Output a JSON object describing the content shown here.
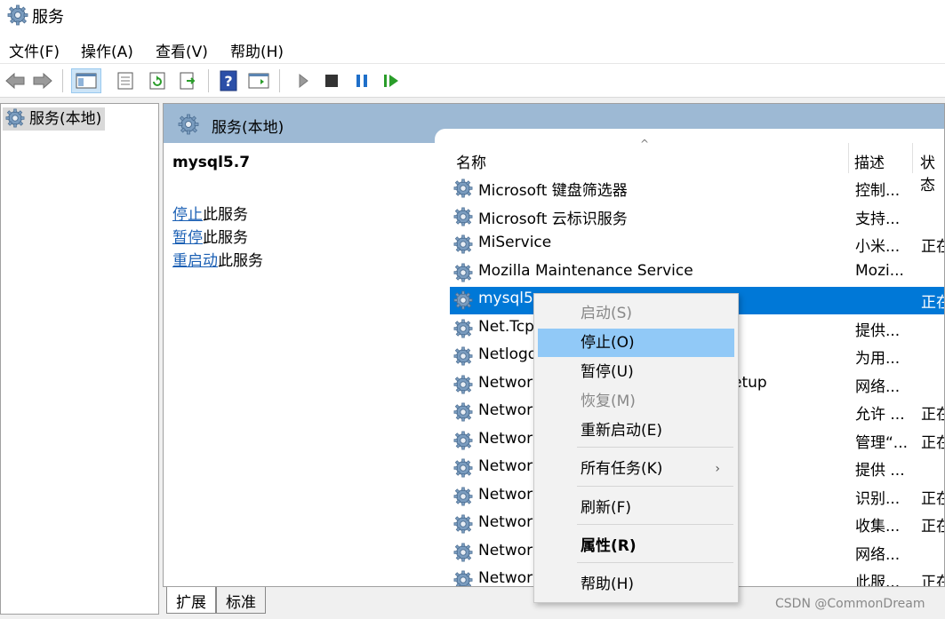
{
  "window": {
    "title": "服务"
  },
  "menubar": [
    "文件(F)",
    "操作(A)",
    "查看(V)",
    "帮助(H)"
  ],
  "toolbar": {
    "buttons": [
      "back-icon",
      "forward-icon",
      "show-tree-icon",
      "properties-icon",
      "refresh-icon",
      "export-icon",
      "help-icon",
      "console-icon",
      "start-icon",
      "stop-icon",
      "pause-icon",
      "restart-icon"
    ]
  },
  "tree": {
    "root_label": "服务(本地)"
  },
  "panel": {
    "header": "服务(本地)",
    "selected_service": "mysql5.7",
    "actions": [
      {
        "link": "停止",
        "suffix": "此服务"
      },
      {
        "link": "暂停",
        "suffix": "此服务"
      },
      {
        "link": "重启动",
        "suffix": "此服务"
      }
    ]
  },
  "columns": {
    "name": "名称",
    "desc": "描述",
    "status": "状态",
    "sort_indicator": "^"
  },
  "services": [
    {
      "name": "Microsoft 键盘筛选器",
      "desc": "控制...",
      "status": ""
    },
    {
      "name": "Microsoft 云标识服务",
      "desc": "支持...",
      "status": ""
    },
    {
      "name": "MiService",
      "desc": "小米...",
      "status": "正在"
    },
    {
      "name": "Mozilla Maintenance Service",
      "desc": "Mozi...",
      "status": ""
    },
    {
      "name": "mysql5.",
      "desc": "",
      "status": "正在",
      "selected": true
    },
    {
      "name": "Net.Tcp",
      "desc": "提供...",
      "status": ""
    },
    {
      "name": "Netlogo",
      "desc": "为用...",
      "status": ""
    },
    {
      "name": "Networ",
      "name_tail": "etup",
      "desc": "网络...",
      "status": ""
    },
    {
      "name": "Networ",
      "desc": "允许 ...",
      "status": "正在"
    },
    {
      "name": "Networ",
      "desc": "管理“...",
      "status": "正在"
    },
    {
      "name": "Networ",
      "desc": "提供 ...",
      "status": ""
    },
    {
      "name": "Networ",
      "desc": "识别...",
      "status": "正在"
    },
    {
      "name": "Networ",
      "desc": "收集...",
      "status": "正在"
    },
    {
      "name": "Networ",
      "desc": "网络...",
      "status": ""
    },
    {
      "name": "Networ",
      "desc": "此服...",
      "status": "正在"
    }
  ],
  "tabs": [
    "扩展",
    "标准"
  ],
  "context_menu": {
    "items": [
      {
        "label": "启动(S)",
        "state": "disabled"
      },
      {
        "label": "停止(O)",
        "state": "hover"
      },
      {
        "label": "暂停(U)",
        "state": "normal"
      },
      {
        "label": "恢复(M)",
        "state": "disabled"
      },
      {
        "label": "重新启动(E)",
        "state": "normal"
      },
      {
        "label": "所有任务(K)",
        "state": "submenu",
        "arrow": "›"
      },
      {
        "label": "刷新(F)",
        "state": "normal"
      },
      {
        "label": "属性(R)",
        "state": "bold"
      },
      {
        "label": "帮助(H)",
        "state": "normal"
      }
    ]
  },
  "watermark": "CSDN @CommonDream"
}
